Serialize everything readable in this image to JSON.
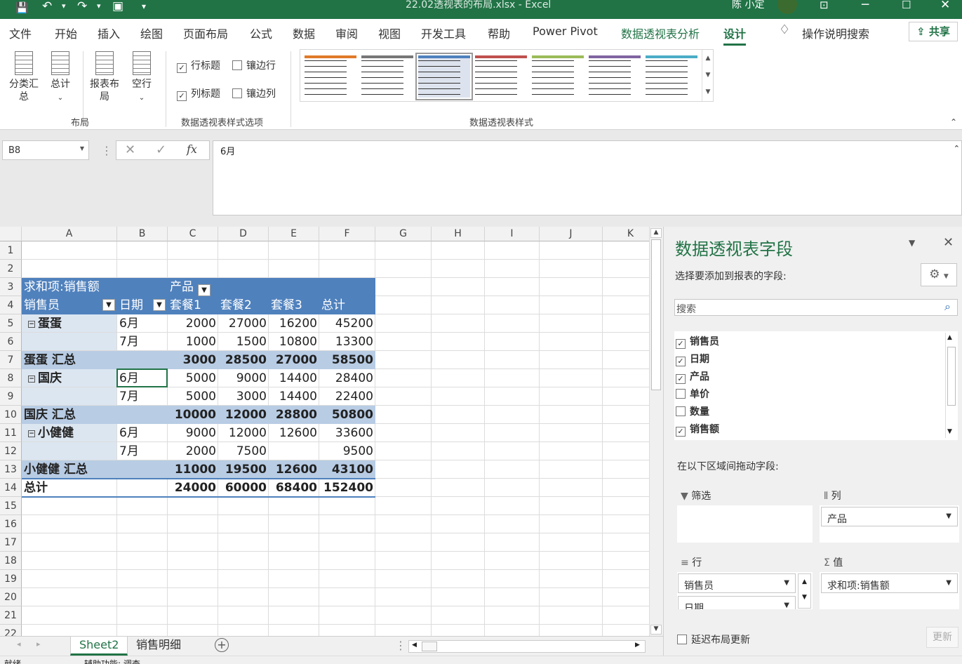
{
  "window": {
    "title": "22.02透视表的布局.xlsx  -  Excel",
    "user": "陈 小定"
  },
  "qat": {
    "save": "💾",
    "undo": "↶",
    "redo": "↷",
    "touch": "▣",
    "more": "▾"
  },
  "tabs": [
    "文件",
    "开始",
    "插入",
    "绘图",
    "页面布局",
    "公式",
    "数据",
    "审阅",
    "视图",
    "开发工具",
    "帮助",
    "Power Pivot",
    "数据透视表分析",
    "设计"
  ],
  "tell_me": "操作说明搜索",
  "share": "共享",
  "ribbon": {
    "layout": {
      "subtotal": "分类汇总",
      "total": "总计",
      "report_layout": "报表布局",
      "blank_rows": "空行",
      "group": "布局"
    },
    "style_options": {
      "row_headers": "行标题",
      "banded_rows": "镶边行",
      "col_headers": "列标题",
      "banded_cols": "镶边列",
      "group": "数据透视表样式选项"
    },
    "styles": {
      "group": "数据透视表样式",
      "colors": [
        "#e07a28",
        "#777777",
        "#4f81bd",
        "#c0504d",
        "#9bbb59",
        "#8064a2",
        "#4bacc6"
      ]
    }
  },
  "formula": {
    "name_box": "B8",
    "value": "6月",
    "fx": "fx"
  },
  "grid": {
    "columns": [
      "A",
      "B",
      "C",
      "D",
      "E",
      "F",
      "G",
      "H",
      "I",
      "J",
      "K"
    ],
    "rows": [
      "1",
      "2",
      "3",
      "4",
      "5",
      "6",
      "7",
      "8",
      "9",
      "10",
      "11",
      "12",
      "13",
      "14",
      "15",
      "16",
      "17",
      "18",
      "19",
      "20",
      "21",
      "22"
    ],
    "pivot": {
      "corner": "求和项:销售额",
      "col_field": "产品",
      "row_field": "销售员",
      "row_field2": "日期",
      "col_headers": [
        "套餐1",
        "套餐2",
        "套餐3",
        "总计"
      ],
      "rows": [
        {
          "type": "first",
          "name": "蛋蛋",
          "month": "6月",
          "vals": [
            "2000",
            "27000",
            "16200",
            "45200"
          ]
        },
        {
          "type": "sub",
          "month": "7月",
          "vals": [
            "1000",
            "1500",
            "10800",
            "13300"
          ]
        },
        {
          "type": "subtotal",
          "name": "蛋蛋 汇总",
          "vals": [
            "3000",
            "28500",
            "27000",
            "58500"
          ]
        },
        {
          "type": "first",
          "name": "国庆",
          "month": "6月",
          "vals": [
            "5000",
            "9000",
            "14400",
            "28400"
          ]
        },
        {
          "type": "sub",
          "month": "7月",
          "vals": [
            "5000",
            "3000",
            "14400",
            "22400"
          ]
        },
        {
          "type": "subtotal",
          "name": "国庆 汇总",
          "vals": [
            "10000",
            "12000",
            "28800",
            "50800"
          ]
        },
        {
          "type": "first",
          "name": "小健健",
          "month": "6月",
          "vals": [
            "9000",
            "12000",
            "12600",
            "33600"
          ]
        },
        {
          "type": "sub",
          "month": "7月",
          "vals": [
            "2000",
            "7500",
            "",
            "9500"
          ]
        },
        {
          "type": "subtotal",
          "name": "小健健 汇总",
          "vals": [
            "11000",
            "19500",
            "12600",
            "43100"
          ]
        },
        {
          "type": "grand",
          "name": "总计",
          "vals": [
            "24000",
            "60000",
            "68400",
            "152400"
          ]
        }
      ]
    }
  },
  "sheets": [
    "Sheet2",
    "销售明细"
  ],
  "status": {
    "ready": "就绪",
    "accessibility": "辅助功能: 调查"
  },
  "pane": {
    "title": "数据透视表字段",
    "choose": "选择要添加到报表的字段:",
    "search_placeholder": "搜索",
    "fields": [
      {
        "name": "销售员",
        "checked": true
      },
      {
        "name": "日期",
        "checked": true
      },
      {
        "name": "产品",
        "checked": true
      },
      {
        "name": "单价",
        "checked": false
      },
      {
        "name": "数量",
        "checked": false
      },
      {
        "name": "销售额",
        "checked": true
      }
    ],
    "drag_label": "在以下区域间拖动字段:",
    "filters": "筛选",
    "columns": "列",
    "rows": "行",
    "values": "值",
    "col_item": "产品",
    "row_items": [
      "销售员",
      "日期"
    ],
    "value_item": "求和项:销售额",
    "defer": "延迟布局更新",
    "update": "更新"
  }
}
